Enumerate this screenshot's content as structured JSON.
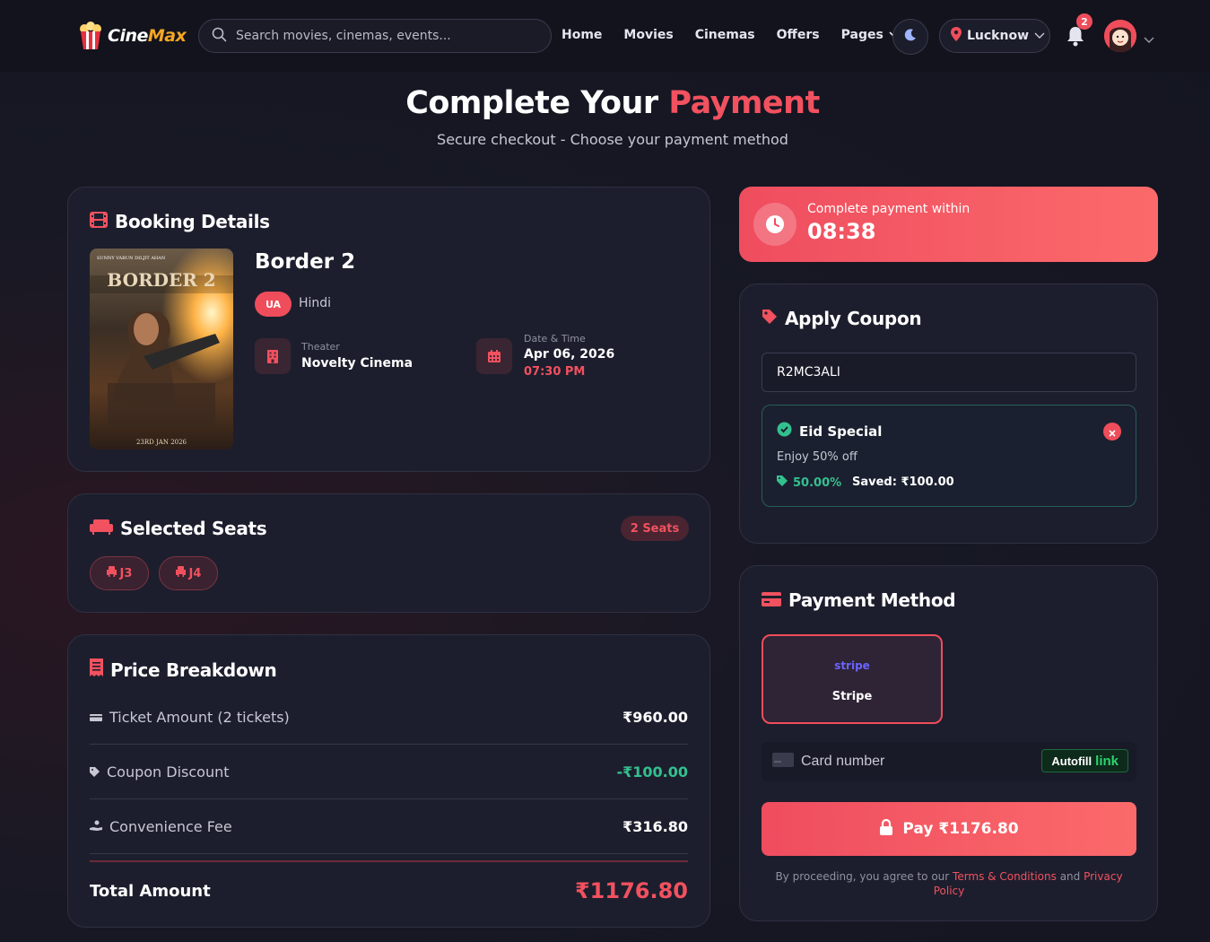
{
  "nav": {
    "brand_a": "Cine",
    "brand_b": "Max",
    "search_placeholder": "Search movies, cinemas, events...",
    "links": [
      "Home",
      "Movies",
      "Cinemas",
      "Offers",
      "Pages"
    ],
    "location": "Lucknow",
    "notification_count": "2"
  },
  "header": {
    "title_a": "Complete Your",
    "title_b": "Payment",
    "subtitle": "Secure checkout - Choose your payment method"
  },
  "booking": {
    "title": "Booking Details",
    "movie": "Border 2",
    "certificate": "UA",
    "language": "Hindi",
    "theater_label": "Theater",
    "theater": "Novelty Cinema",
    "datetime_label": "Date & Time",
    "date": "Apr 06, 2026",
    "time": "07:30 PM",
    "poster": {
      "title": "BORDER 2",
      "release": "23RD JAN 2026"
    }
  },
  "seats": {
    "title": "Selected Seats",
    "count_label": "2 Seats",
    "items": [
      "J3",
      "J4"
    ]
  },
  "price": {
    "title": "Price Breakdown",
    "rows": [
      {
        "label": "Ticket Amount (2 tickets)",
        "value": "₹960.00"
      },
      {
        "label": "Coupon Discount",
        "value": "-₹100.00"
      },
      {
        "label": "Convenience Fee",
        "value": "₹316.80"
      }
    ],
    "total_label": "Total Amount",
    "total_value": "₹1176.80"
  },
  "timer": {
    "label": "Complete payment within",
    "value": "08:38"
  },
  "coupon": {
    "title": "Apply Coupon",
    "code": "R2MC3ALI",
    "name": "Eid Special",
    "description": "Enjoy 50% off",
    "percent": "50.00%",
    "saved": "Saved: ₹100.00"
  },
  "payment": {
    "title": "Payment Method",
    "method_logo": "stripe",
    "method_name": "Stripe",
    "card_placeholder": "Card number",
    "autofill": "Autofill",
    "autofill_link": "link",
    "pay_label": "Pay ₹1176.80",
    "terms_a": "By proceeding, you agree to our ",
    "terms_link1": "Terms & Conditions",
    "terms_b": " and ",
    "terms_link2": "Privacy Policy"
  },
  "colors": {
    "accent": "#f2515f",
    "success": "#33c08f",
    "background": "#141521",
    "card": "#1d1e2d"
  }
}
